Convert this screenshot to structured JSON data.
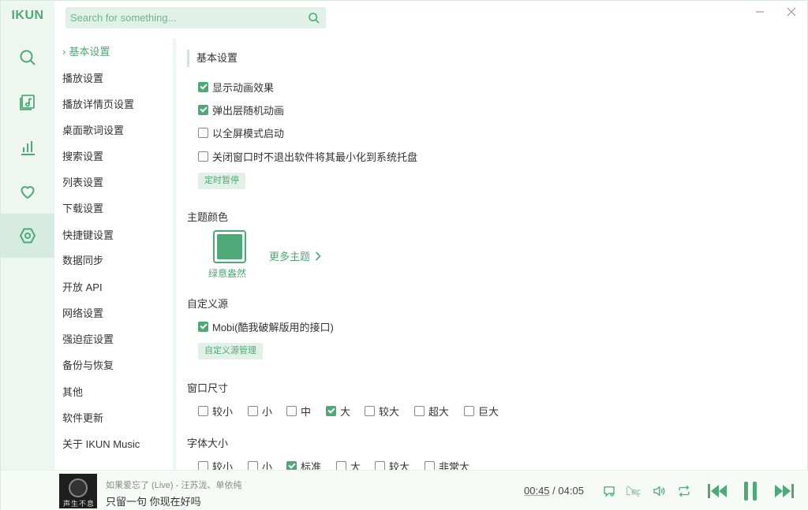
{
  "app": {
    "logo": "IKUN"
  },
  "search": {
    "placeholder": "Search for something..."
  },
  "rail": {
    "items": [
      {
        "name": "search-icon"
      },
      {
        "name": "music-library-icon"
      },
      {
        "name": "chart-icon"
      },
      {
        "name": "heart-icon"
      },
      {
        "name": "settings-icon",
        "active": true
      }
    ]
  },
  "nav": {
    "items": [
      {
        "label": "基本设置",
        "active": true
      },
      {
        "label": "播放设置"
      },
      {
        "label": "播放详情页设置"
      },
      {
        "label": "桌面歌词设置"
      },
      {
        "label": "搜索设置"
      },
      {
        "label": "列表设置"
      },
      {
        "label": "下载设置"
      },
      {
        "label": "快捷键设置"
      },
      {
        "label": "数据同步"
      },
      {
        "label": "开放 API"
      },
      {
        "label": "网络设置"
      },
      {
        "label": "强迫症设置"
      },
      {
        "label": "备份与恢复"
      },
      {
        "label": "其他"
      },
      {
        "label": "软件更新"
      },
      {
        "label": "关于 IKUN Music"
      }
    ]
  },
  "basic": {
    "title": "基本设置",
    "options": [
      {
        "label": "显示动画效果",
        "checked": true
      },
      {
        "label": "弹出层随机动画",
        "checked": true
      },
      {
        "label": "以全屏模式启动",
        "checked": false
      },
      {
        "label": "关闭窗口时不退出软件将其最小化到系统托盘",
        "checked": false
      }
    ],
    "timer_button": "定时暂停"
  },
  "theme": {
    "title": "主题颜色",
    "current_name": "绿意盎然",
    "current_color": "#4daa76",
    "more_label": "更多主题"
  },
  "source": {
    "title": "自定义源",
    "option": {
      "label": "Mobi(酷我破解版用的接口)",
      "checked": true
    },
    "manage_button": "自定义源管理"
  },
  "window_size": {
    "title": "窗口尺寸",
    "options": [
      {
        "label": "较小",
        "checked": false
      },
      {
        "label": "小",
        "checked": false
      },
      {
        "label": "中",
        "checked": false
      },
      {
        "label": "大",
        "checked": true
      },
      {
        "label": "较大",
        "checked": false
      },
      {
        "label": "超大",
        "checked": false
      },
      {
        "label": "巨大",
        "checked": false
      }
    ]
  },
  "font_size": {
    "title": "字体大小",
    "options": [
      {
        "label": "较小",
        "checked": false
      },
      {
        "label": "小",
        "checked": false
      },
      {
        "label": "标准",
        "checked": true
      },
      {
        "label": "大",
        "checked": false
      },
      {
        "label": "较大",
        "checked": false
      },
      {
        "label": "非常大",
        "checked": false
      }
    ]
  },
  "player": {
    "cover_text": "声生不息",
    "title": "如果爱忘了 (Live) - 汪苏泷、单依纯",
    "lyric": "只留一句 你现在好吗",
    "current_time": "00:45",
    "separator": "/",
    "total_time": "04:05"
  },
  "colors": {
    "accent": "#4daa76",
    "accent_light": "#e2f1e7",
    "rail_bg": "#eef6f0"
  }
}
